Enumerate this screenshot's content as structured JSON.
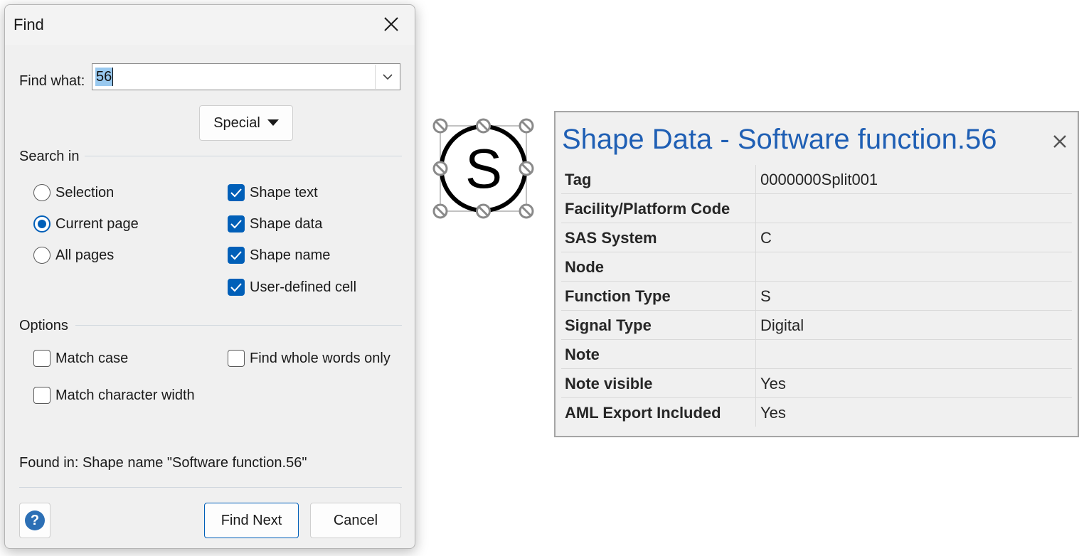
{
  "find_dialog": {
    "title": "Find",
    "find_what_label": "Find what:",
    "find_what_value": "56",
    "special_label": "Special",
    "search_in_label": "Search in",
    "search_in_options": [
      {
        "label": "Selection",
        "selected": false
      },
      {
        "label": "Current page",
        "selected": true
      },
      {
        "label": "All pages",
        "selected": false
      }
    ],
    "search_in_checks": [
      {
        "label": "Shape text",
        "checked": true
      },
      {
        "label": "Shape data",
        "checked": true
      },
      {
        "label": "Shape name",
        "checked": true
      },
      {
        "label": "User-defined cell",
        "checked": true
      }
    ],
    "options_label": "Options",
    "options": [
      {
        "label": "Match case",
        "checked": false
      },
      {
        "label": "Find whole words only",
        "checked": false
      },
      {
        "label": "Match character width",
        "checked": false
      }
    ],
    "found_in": "Found in:  Shape name \"Software function.56\"",
    "help_glyph": "?",
    "find_next_label": "Find Next",
    "cancel_label": "Cancel"
  },
  "shape": {
    "letter": "S"
  },
  "shape_data": {
    "title": "Shape Data - Software function.56",
    "rows": [
      {
        "key": "Tag",
        "value": "0000000Split001"
      },
      {
        "key": "Facility/Platform Code",
        "value": ""
      },
      {
        "key": "SAS System",
        "value": "C"
      },
      {
        "key": "Node",
        "value": ""
      },
      {
        "key": "Function Type",
        "value": "S"
      },
      {
        "key": "Signal Type",
        "value": "Digital"
      },
      {
        "key": "Note",
        "value": ""
      },
      {
        "key": "Note visible",
        "value": "Yes"
      },
      {
        "key": "AML Export Included",
        "value": "Yes"
      }
    ]
  },
  "colors": {
    "accent": "#005fb8",
    "panel_title": "#1f5fb4",
    "selection_highlight": "#99c9ef"
  }
}
